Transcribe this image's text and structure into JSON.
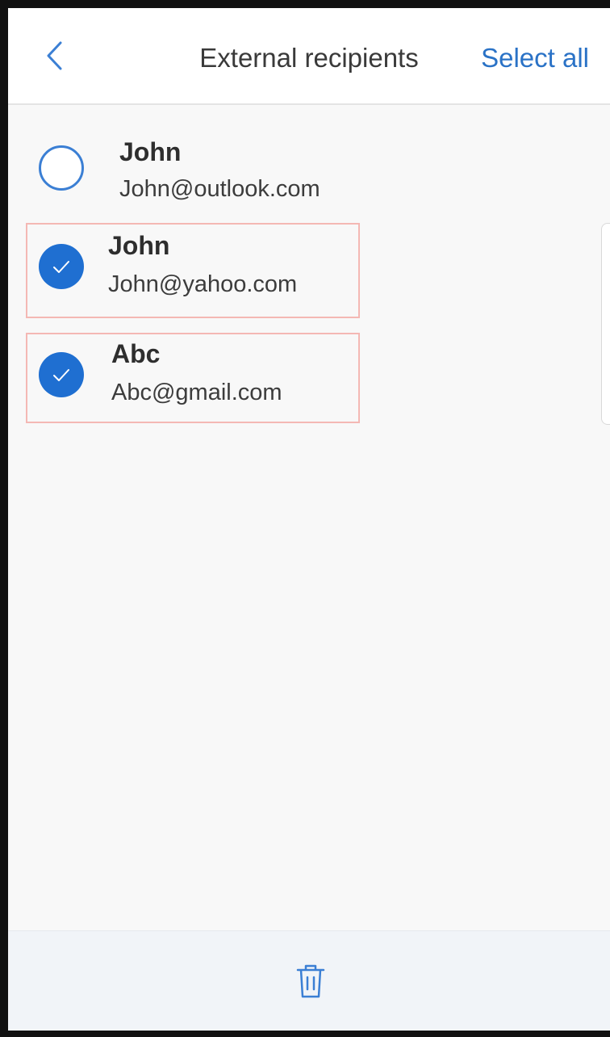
{
  "header": {
    "back_icon": "chevron-left-icon",
    "title": "External recipients",
    "select_all_label": "Select all"
  },
  "recipients": [
    {
      "name": "John",
      "email": "John@outlook.com",
      "selected": false
    },
    {
      "name": "John",
      "email": "John@yahoo.com",
      "selected": true
    },
    {
      "name": "Abc",
      "email": "Abc@gmail.com",
      "selected": true
    }
  ],
  "footer": {
    "delete_icon": "trash-icon"
  },
  "colors": {
    "accent": "#2a72c6",
    "selected_outline": "#f4b8b4",
    "check_fill": "#1f6fd1",
    "background": "#f8f8f8"
  }
}
